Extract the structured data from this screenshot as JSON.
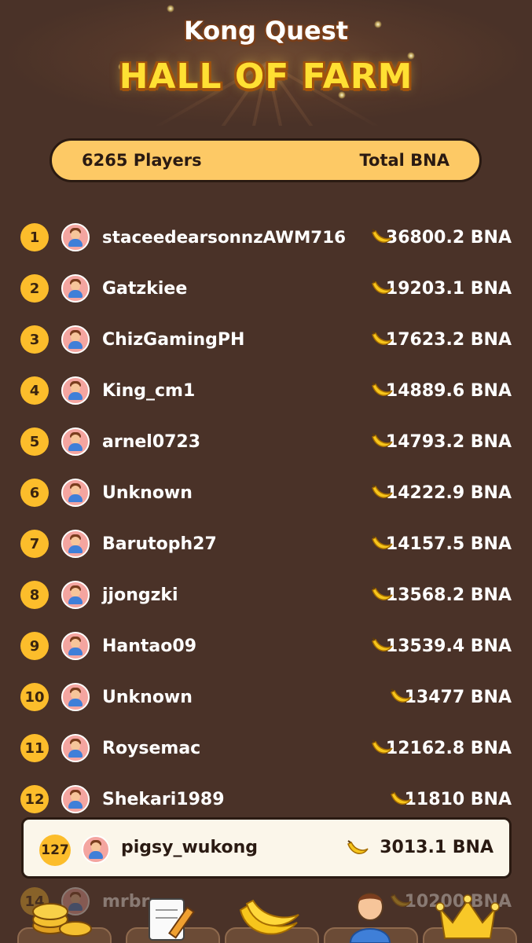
{
  "header": {
    "brand": "Kong Quest",
    "title": "HALL OF FARM"
  },
  "summary": {
    "players": "6265 Players",
    "total_label": "Total BNA"
  },
  "leaderboard": [
    {
      "rank": "1",
      "name": "staceedearsonnzAWM716",
      "score": "36800.2 BNA"
    },
    {
      "rank": "2",
      "name": "Gatzkiee",
      "score": "19203.1 BNA"
    },
    {
      "rank": "3",
      "name": "ChizGamingPH",
      "score": "17623.2 BNA"
    },
    {
      "rank": "4",
      "name": "King_cm1",
      "score": "14889.6 BNA"
    },
    {
      "rank": "5",
      "name": "arnel0723",
      "score": "14793.2 BNA"
    },
    {
      "rank": "6",
      "name": "Unknown",
      "score": "14222.9 BNA"
    },
    {
      "rank": "7",
      "name": "Barutoph27",
      "score": "14157.5 BNA"
    },
    {
      "rank": "8",
      "name": "jjongzki",
      "score": "13568.2 BNA"
    },
    {
      "rank": "9",
      "name": "Hantao09",
      "score": "13539.4 BNA"
    },
    {
      "rank": "10",
      "name": "Unknown",
      "score": "13477 BNA"
    },
    {
      "rank": "11",
      "name": "Roysemac",
      "score": "12162.8 BNA"
    },
    {
      "rank": "12",
      "name": "Shekari1989",
      "score": "11810 BNA"
    }
  ],
  "partial_row": {
    "rank": "14",
    "name": "mrbr",
    "score": "10200 BNA"
  },
  "current_user": {
    "rank": "127",
    "name": "pigsy_wukong",
    "score": "3013.1 BNA"
  },
  "nav": [
    {
      "icon": "coins-icon"
    },
    {
      "icon": "notepad-pencil-icon"
    },
    {
      "icon": "banana-bunch-icon"
    },
    {
      "icon": "profile-person-icon"
    },
    {
      "icon": "crown-icon"
    }
  ],
  "colors": {
    "background": "#4a3228",
    "summary_bar": "#fdc965",
    "rank_badge": "#fcbd2b",
    "title_yellow": "#ffe033",
    "current_user_bg": "#fbf6ea"
  }
}
